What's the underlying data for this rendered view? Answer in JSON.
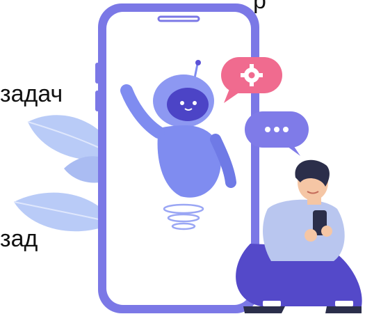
{
  "text_fragments": {
    "top": "р",
    "left": "задач",
    "bottom": "зад"
  },
  "illustration": {
    "icons": [
      "phone-icon",
      "robot-icon",
      "gear-chat-bubble-icon",
      "typing-chat-bubble-icon",
      "person-with-phone-icon",
      "leaf-decoration-icon"
    ],
    "colors": {
      "phone_frame": "#7b78e6",
      "screen": "#ffffff",
      "robot_body": "#7f8cf0",
      "robot_face": "#4c44c6",
      "bubble_pink": "#f06b8f",
      "bubble_purple": "#7f7be8",
      "leaves": "#b9cbf7",
      "shirt": "#b9c6ef",
      "pants": "#5449c9",
      "hair": "#2b2e4a",
      "skin": "#f5c6a5"
    }
  }
}
